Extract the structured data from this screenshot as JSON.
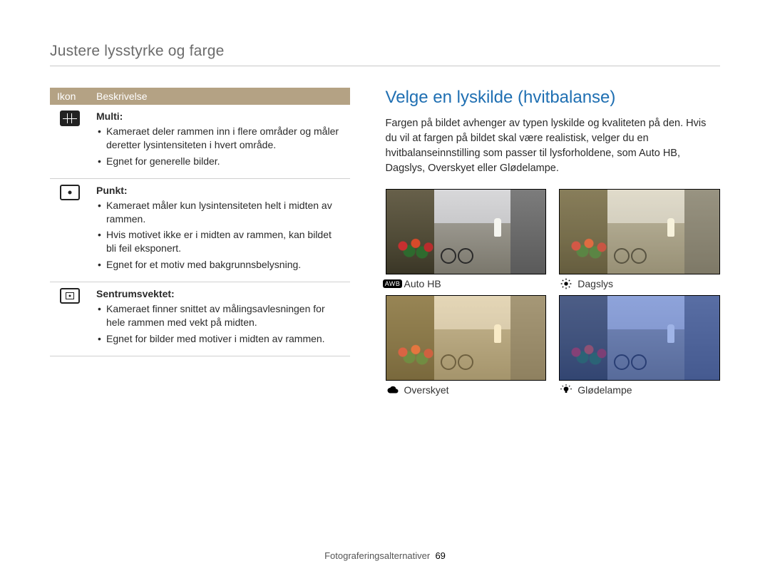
{
  "section_title": "Justere lysstyrke og farge",
  "table": {
    "headers": {
      "icon": "Ikon",
      "desc": "Beskrivelse"
    },
    "rows": [
      {
        "icon_name": "metering-multi-icon",
        "title": "Multi:",
        "bullets": [
          "Kameraet deler rammen inn i flere områder og måler deretter lysintensiteten i hvert område.",
          "Egnet for generelle bilder."
        ]
      },
      {
        "icon_name": "metering-spot-icon",
        "title": "Punkt:",
        "bullets": [
          "Kameraet måler kun lysintensiteten helt i midten av rammen.",
          "Hvis motivet ikke er i midten av rammen, kan bildet bli feil eksponert.",
          "Egnet for et motiv med bakgrunnsbelysning."
        ]
      },
      {
        "icon_name": "metering-center-icon",
        "title": "Sentrumsvektet:",
        "bullets": [
          "Kameraet finner snittet av målingsavlesningen for hele rammen med vekt på midten.",
          "Egnet for bilder med motiver i midten av rammen."
        ]
      }
    ]
  },
  "right": {
    "heading": "Velge en lyskilde (hvitbalanse)",
    "paragraph": "Fargen på bildet avhenger av typen lyskilde og kvaliteten på den. Hvis du vil at fargen på bildet skal være realistisk, velger du en hvitbalanseinnstilling som passer til lysforholdene, som Auto HB, Dagslys, Overskyet eller Glødelampe.",
    "samples": [
      {
        "icon": "awb",
        "label": "Auto HB",
        "tint": "tint-auto"
      },
      {
        "icon": "sun",
        "label": "Dagslys",
        "tint": "tint-daylight"
      },
      {
        "icon": "cloud",
        "label": "Overskyet",
        "tint": "tint-cloudy"
      },
      {
        "icon": "bulb",
        "label": "Glødelampe",
        "tint": "tint-tungsten"
      }
    ]
  },
  "footer": {
    "chapter": "Fotograferingsalternativer",
    "page": "69"
  }
}
